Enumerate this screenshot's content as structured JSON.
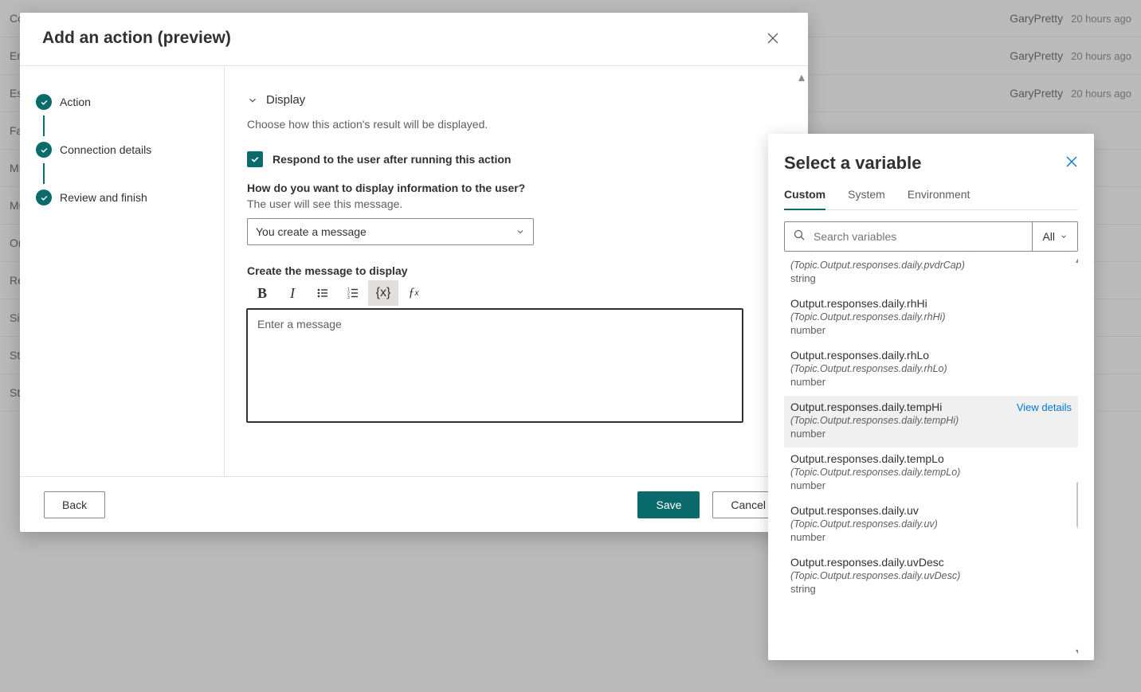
{
  "background_rows": {
    "left": [
      "Co",
      "En",
      "Es",
      "Fal",
      "MS",
      "Mu",
      "On",
      "Re",
      "Sig",
      "Sto",
      "Sto"
    ],
    "right_visible": [
      {
        "author": "GaryPretty",
        "time": "20 hours ago"
      },
      {
        "author": "GaryPretty",
        "time": "20 hours ago"
      },
      {
        "author": "GaryPretty",
        "time": "20 hours ago"
      }
    ]
  },
  "dialog": {
    "title": "Add an action (preview)",
    "steps": [
      "Action",
      "Connection details",
      "Review and finish"
    ],
    "section_display": "Display",
    "section_desc": "Choose how this action's result will be displayed.",
    "respond_checkbox_label": "Respond to the user after running this action",
    "how_display_label": "How do you want to display information to the user?",
    "user_will_see": "The user will see this message.",
    "select_value": "You create a message",
    "create_msg_label": "Create the message to display",
    "editor_placeholder": "Enter a message",
    "footer": {
      "back": "Back",
      "save": "Save",
      "cancel": "Cancel"
    }
  },
  "varpanel": {
    "title": "Select a variable",
    "tabs": [
      "Custom",
      "System",
      "Environment"
    ],
    "search_placeholder": "Search variables",
    "filter_label": "All",
    "top_partial": {
      "path": "(Topic.Output.responses.daily.pvdrCap)",
      "type": "string"
    },
    "items": [
      {
        "name": "Output.responses.daily.rhHi",
        "path": "(Topic.Output.responses.daily.rhHi)",
        "type": "number"
      },
      {
        "name": "Output.responses.daily.rhLo",
        "path": "(Topic.Output.responses.daily.rhLo)",
        "type": "number"
      },
      {
        "name": "Output.responses.daily.tempHi",
        "path": "(Topic.Output.responses.daily.tempHi)",
        "type": "number",
        "selected": true,
        "view_details": "View details"
      },
      {
        "name": "Output.responses.daily.tempLo",
        "path": "(Topic.Output.responses.daily.tempLo)",
        "type": "number"
      },
      {
        "name": "Output.responses.daily.uv",
        "path": "(Topic.Output.responses.daily.uv)",
        "type": "number"
      },
      {
        "name": "Output.responses.daily.uvDesc",
        "path": "(Topic.Output.responses.daily.uvDesc)",
        "type": "string"
      }
    ]
  }
}
